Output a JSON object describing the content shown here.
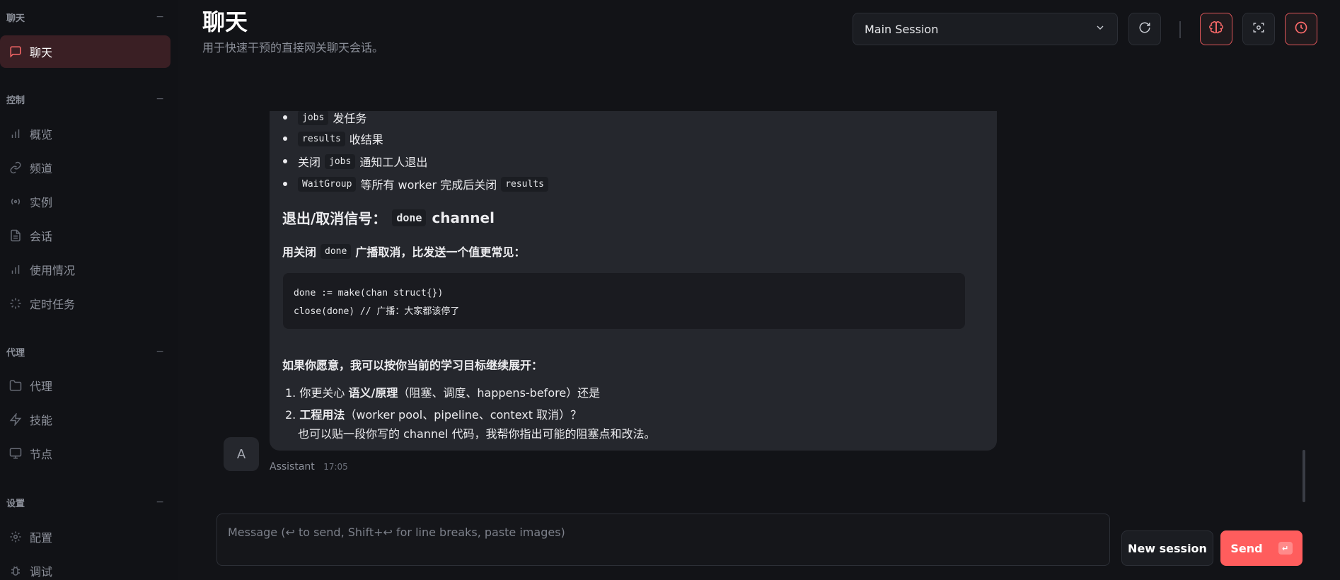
{
  "sidebar": {
    "groups": [
      {
        "title": "聊天",
        "items": [
          {
            "label": "聊天",
            "icon": "message-icon",
            "active": true
          }
        ]
      },
      {
        "title": "控制",
        "items": [
          {
            "label": "概览",
            "icon": "bar-chart-icon"
          },
          {
            "label": "频道",
            "icon": "link-icon"
          },
          {
            "label": "实例",
            "icon": "radio-icon"
          },
          {
            "label": "会话",
            "icon": "document-icon"
          },
          {
            "label": "使用情况",
            "icon": "bar-chart-icon"
          },
          {
            "label": "定时任务",
            "icon": "loader-icon"
          }
        ]
      },
      {
        "title": "代理",
        "items": [
          {
            "label": "代理",
            "icon": "folder-icon"
          },
          {
            "label": "技能",
            "icon": "bolt-icon"
          },
          {
            "label": "节点",
            "icon": "monitor-icon"
          }
        ]
      },
      {
        "title": "设置",
        "items": [
          {
            "label": "配置",
            "icon": "gear-icon"
          },
          {
            "label": "调试",
            "icon": "bug-icon"
          }
        ]
      }
    ],
    "collapse_symbol": "−"
  },
  "header": {
    "title": "聊天",
    "subtitle": "用于快速干预的直接网关聊天会话。",
    "session_value": "Main Session"
  },
  "message": {
    "list_items": [
      {
        "code": "jobs",
        "text": "发任务"
      },
      {
        "code": "results",
        "text": "收结果"
      },
      {
        "pre": "关闭",
        "code": "jobs",
        "text": "通知工人退出"
      },
      {
        "code": "WaitGroup",
        "text": "等所有 worker 完成后关闭",
        "code2": "results"
      }
    ],
    "heading_pre": "退出/取消信号：",
    "heading_code": "done",
    "heading_post": "channel",
    "para1_pre": "用关闭",
    "para1_code": "done",
    "para1_post": "广播取消，比发送一个值更常见：",
    "code_lines": [
      "done := make(chan struct{})",
      "close(done) // 广播：大家都该停了"
    ],
    "para2": "如果你愿意，我可以按你当前的学习目标继续展开：",
    "ol1_pre": "你更关心",
    "ol1_bold": "语义/原理",
    "ol1_post": "（阻塞、调度、happens-before）还是",
    "ol2_bold": "工程用法",
    "ol2_post": "（worker pool、pipeline、context 取消）？",
    "ol2_line2": "也可以贴一段你写的 channel 代码，我帮你指出可能的阻塞点和改法。",
    "avatar_letter": "A",
    "author": "Assistant",
    "time": "17:05"
  },
  "composer": {
    "placeholder": "Message (↩ to send, Shift+↩ for line breaks, paste images)",
    "new_session_label": "New session",
    "send_label": "Send",
    "send_kbd": "↵"
  },
  "colors": {
    "accent": "#ff5d5d",
    "background": "#121317",
    "bubble": "#25272d"
  }
}
